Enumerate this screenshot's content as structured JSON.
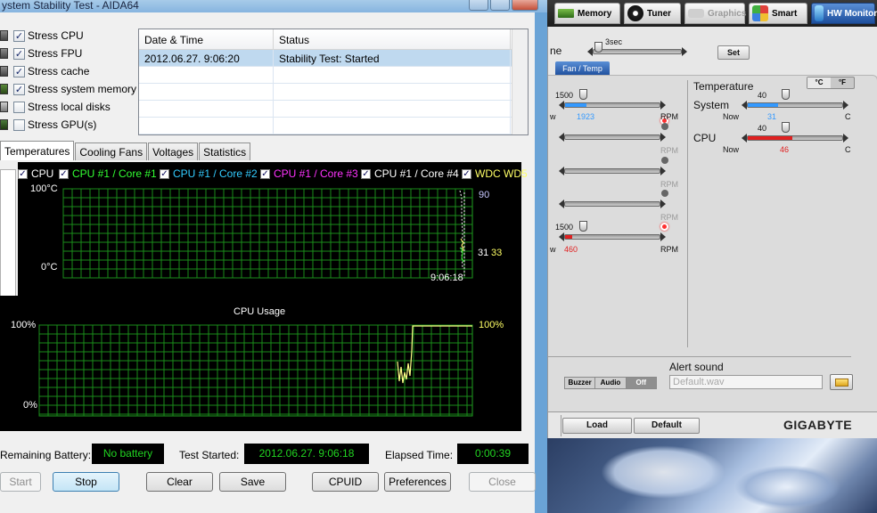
{
  "aida": {
    "title": "ystem Stability Test - AIDA64",
    "stress": [
      {
        "label": "Stress CPU",
        "checked": true
      },
      {
        "label": "Stress FPU",
        "checked": true
      },
      {
        "label": "Stress cache",
        "checked": true
      },
      {
        "label": "Stress system memory",
        "checked": true
      },
      {
        "label": "Stress local disks",
        "checked": false
      },
      {
        "label": "Stress GPU(s)",
        "checked": false
      }
    ],
    "log": {
      "columns": [
        "Date & Time",
        "Status"
      ],
      "rows": [
        {
          "date": "2012.06.27. 9:06:20",
          "status": "Stability Test: Started"
        }
      ]
    },
    "tabs": [
      "Temperatures",
      "Cooling Fans",
      "Voltages",
      "Statistics"
    ],
    "temp_legend": [
      {
        "label": "CPU",
        "color": "#ffffff"
      },
      {
        "label": "CPU #1 / Core #1",
        "color": "#33ff33"
      },
      {
        "label": "CPU #1 / Core #2",
        "color": "#33ccff"
      },
      {
        "label": "CPU #1 / Core #3",
        "color": "#ff33ff"
      },
      {
        "label": "CPU #1 / Core #4",
        "color": "#ffffff"
      },
      {
        "label": "WDC WD5",
        "color": "#ffff66"
      }
    ],
    "temp_chart": {
      "y_max": "100°C",
      "y_min": "0°C",
      "time": "9:06:18",
      "val_90": "90",
      "val_31": "31",
      "val_33": "33"
    },
    "cpu_chart": {
      "title": "CPU Usage",
      "y_max": "100%",
      "y_min": "0%",
      "value": "100%"
    },
    "info": {
      "battery_label": "Remaining Battery:",
      "battery_value": "No battery",
      "started_label": "Test Started:",
      "started_value": "2012.06.27. 9:06:18",
      "elapsed_label": "Elapsed Time:",
      "elapsed_value": "0:00:39"
    },
    "buttons": {
      "start": "Start",
      "stop": "Stop",
      "clear": "Clear",
      "save": "Save",
      "cpuid": "CPUID",
      "preferences": "Preferences",
      "close": "Close"
    }
  },
  "easytune": {
    "tabs": {
      "memory": "Memory",
      "tuner": "Tuner",
      "graphics": "Graphics",
      "smart": "Smart",
      "hw_monitor": "HW Monitor"
    },
    "partial_label": "ne",
    "interval": "3sec",
    "set_btn": "Set",
    "subtab": "Fan / Temp",
    "fans": [
      {
        "target": "1500",
        "now": "1923",
        "unit": "RPM",
        "now_label": "w",
        "color": "#3399ff",
        "alert": true
      },
      {
        "target": "",
        "now": "",
        "unit": "RPM",
        "now_label": "w",
        "color": "",
        "alert": false
      },
      {
        "target": "",
        "now": "",
        "unit": "RPM",
        "now_label": "w",
        "color": "",
        "alert": false
      },
      {
        "target": "",
        "now": "",
        "unit": "RPM",
        "now_label": "w",
        "color": "",
        "alert": false
      },
      {
        "target": "1500",
        "now": "460",
        "unit": "RPM",
        "now_label": "w",
        "color": "#e02020",
        "alert": true
      }
    ],
    "temperature": {
      "title": "Temperature",
      "unit_toggle": {
        "c": "°C",
        "f": "°F"
      },
      "system": {
        "label": "System",
        "limit": "40",
        "now_label": "Now",
        "now": "31",
        "unit": "C",
        "color": "#3399ff"
      },
      "cpu": {
        "label": "CPU",
        "limit": "40",
        "now_label": "Now",
        "now": "46",
        "unit": "C",
        "color": "#e02020"
      }
    },
    "alert_sound": {
      "title": "Alert sound",
      "buzzer": "Buzzer",
      "audio": "Audio",
      "off": "Off",
      "file_placeholder": "Default.wav"
    },
    "bottom": {
      "load": "Load",
      "default": "Default",
      "brand": "GIGABYTE"
    }
  }
}
